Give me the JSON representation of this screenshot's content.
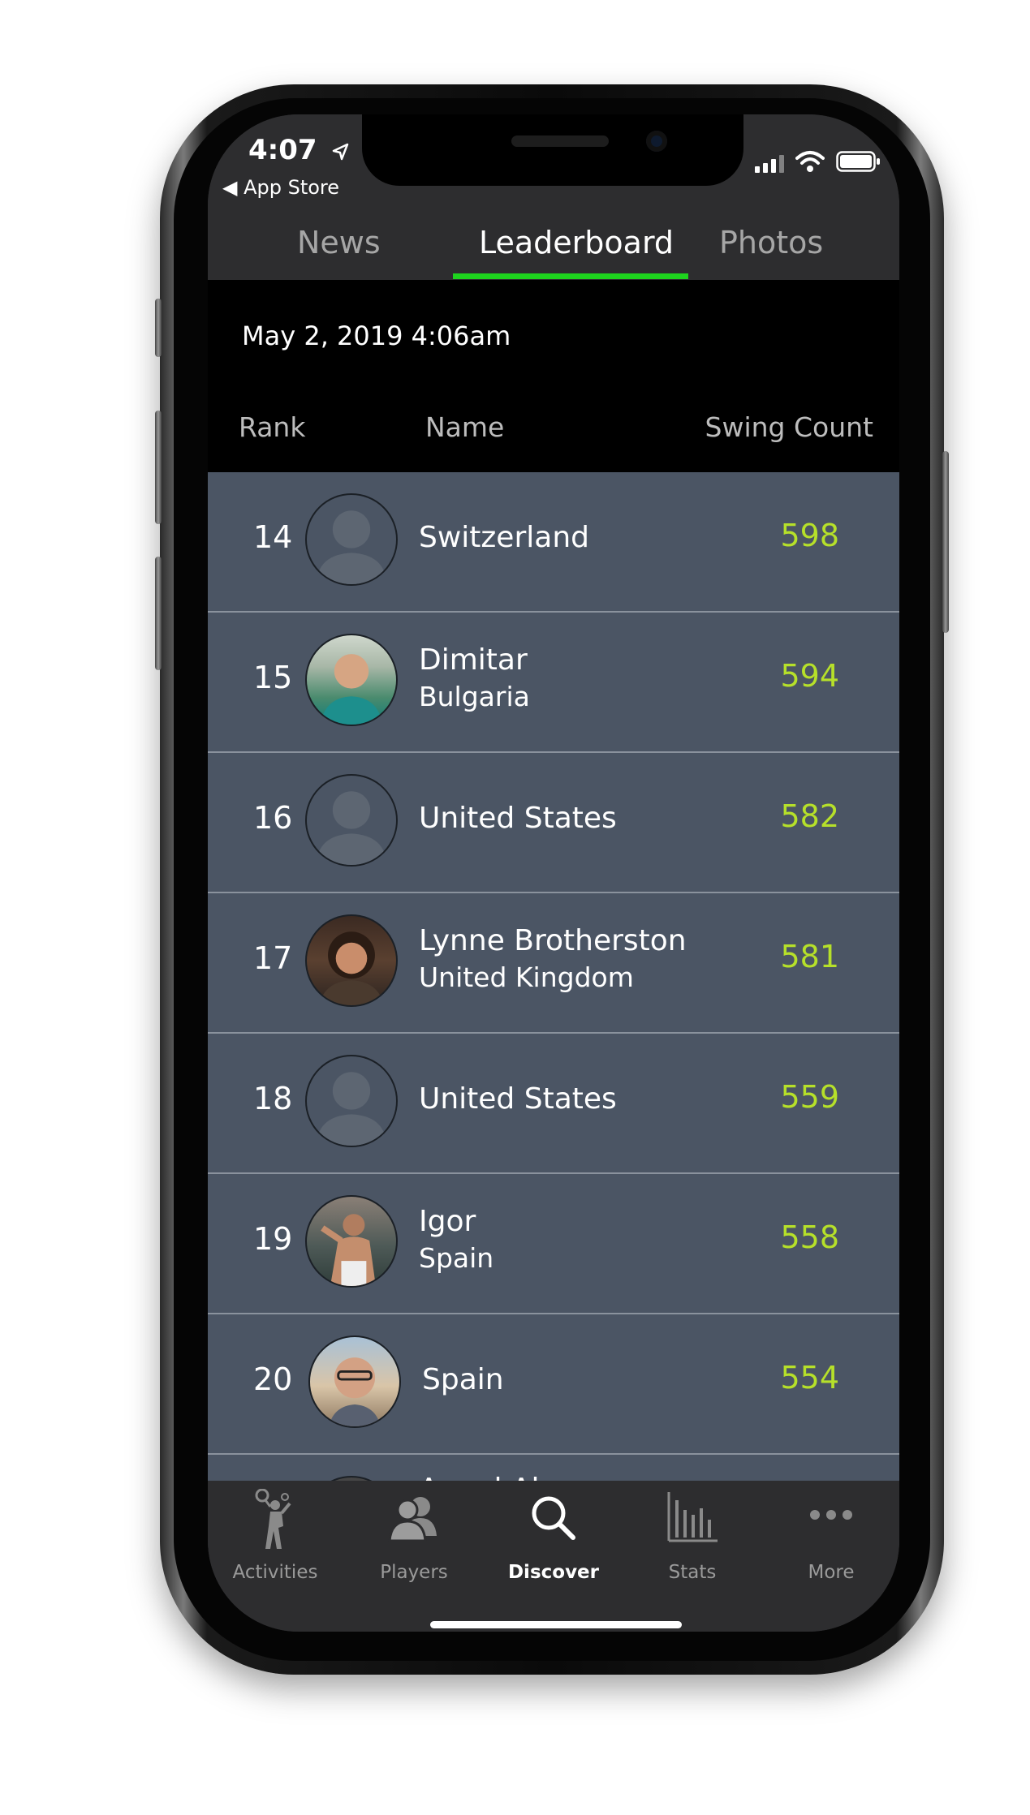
{
  "status_bar": {
    "time": "4:07",
    "back_label": "◀ App Store"
  },
  "top_tabs": [
    {
      "label": "News",
      "active": false
    },
    {
      "label": "Leaderboard",
      "active": true
    },
    {
      "label": "Photos",
      "active": false
    }
  ],
  "leaderboard": {
    "date": "May 2, 2019 4:06am",
    "columns": {
      "rank": "Rank",
      "name": "Name",
      "count": "Swing Count"
    },
    "rows": [
      {
        "rank": "14",
        "name": "",
        "country": "Switzerland",
        "count": "598",
        "avatar": "placeholder-avatar"
      },
      {
        "rank": "15",
        "name": "Dimitar",
        "country": "Bulgaria",
        "count": "594",
        "avatar": "photo-avatar"
      },
      {
        "rank": "16",
        "name": "",
        "country": "United States",
        "count": "582",
        "avatar": "placeholder-avatar"
      },
      {
        "rank": "17",
        "name": "Lynne  Brotherston",
        "country": "United Kingdom",
        "count": "581",
        "avatar": "photo-avatar"
      },
      {
        "rank": "18",
        "name": "",
        "country": "United States",
        "count": "559",
        "avatar": "placeholder-avatar"
      },
      {
        "rank": "19",
        "name": "Igor",
        "country": "Spain",
        "count": "558",
        "avatar": "photo-avatar"
      },
      {
        "rank": "20",
        "name": "",
        "country": "Spain",
        "count": "554",
        "avatar": "photo-avatar"
      },
      {
        "rank": "",
        "name": "Angel Alonso",
        "country": "",
        "count": "",
        "avatar": "photo-avatar"
      }
    ]
  },
  "tab_bar": [
    {
      "label": "Activities",
      "icon": "tennis-player-icon",
      "active": false
    },
    {
      "label": "Players",
      "icon": "players-icon",
      "active": false
    },
    {
      "label": "Discover",
      "icon": "search-icon",
      "active": true
    },
    {
      "label": "Stats",
      "icon": "bar-chart-icon",
      "active": false
    },
    {
      "label": "More",
      "icon": "more-dots-icon",
      "active": false
    }
  ],
  "colors": {
    "accent_green": "#1ed31e",
    "count_color": "#b6e02a",
    "row_background": "#4b5564",
    "bar_background": "#2d2d2f"
  }
}
